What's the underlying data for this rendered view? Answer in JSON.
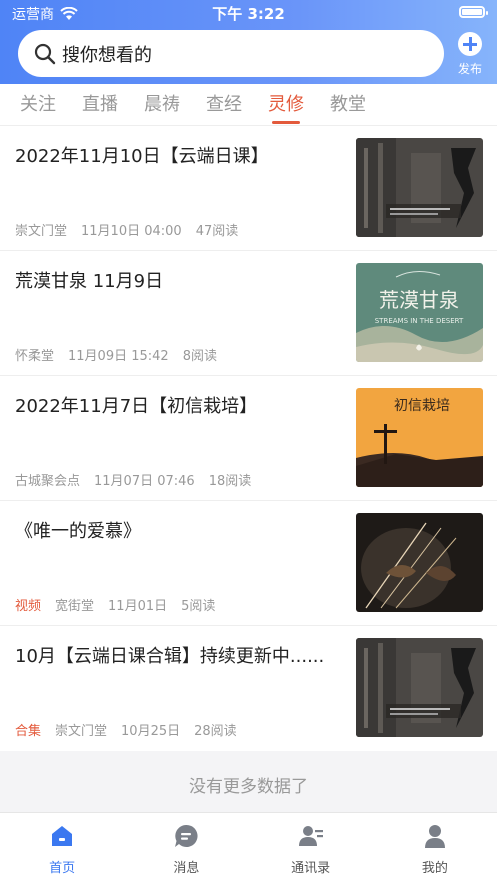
{
  "status": {
    "carrier": "运营商",
    "time": "下午 3:22"
  },
  "search": {
    "placeholder": "搜你想看的",
    "publish_label": "发布"
  },
  "tabs": [
    {
      "label": "关注",
      "active": false
    },
    {
      "label": "直播",
      "active": false
    },
    {
      "label": "晨祷",
      "active": false
    },
    {
      "label": "查经",
      "active": false
    },
    {
      "label": "灵修",
      "active": true
    },
    {
      "label": "教堂",
      "active": false
    }
  ],
  "articles": [
    {
      "title": "2022年11月10日【云端日课】",
      "tag": "",
      "source": "崇文门堂",
      "date": "11月10日 04:00",
      "reads": "47阅读",
      "thumb_text": ""
    },
    {
      "title": "荒漠甘泉 11月9日",
      "tag": "",
      "source": "怀柔堂",
      "date": "11月09日 15:42",
      "reads": "8阅读",
      "thumb_text": "荒漠甘泉",
      "thumb_subtext": "STREAMS IN THE DESERT"
    },
    {
      "title": "2022年11月7日【初信栽培】",
      "tag": "",
      "source": "古城聚会点",
      "date": "11月07日 07:46",
      "reads": "18阅读",
      "thumb_text": "初信栽培"
    },
    {
      "title": "《唯一的爱慕》",
      "tag": "视频",
      "source": "宽街堂",
      "date": "11月01日",
      "reads": "5阅读",
      "thumb_text": ""
    },
    {
      "title": "10月【云端日课合辑】持续更新中......",
      "tag": "合集",
      "source": "崇文门堂",
      "date": "10月25日",
      "reads": "28阅读",
      "thumb_text": ""
    }
  ],
  "footer_text": "没有更多数据了",
  "tabbar": [
    {
      "label": "首页",
      "icon": "home-icon",
      "active": true
    },
    {
      "label": "消息",
      "icon": "message-icon",
      "active": false
    },
    {
      "label": "通讯录",
      "icon": "contacts-icon",
      "active": false
    },
    {
      "label": "我的",
      "icon": "profile-icon",
      "active": false
    }
  ]
}
